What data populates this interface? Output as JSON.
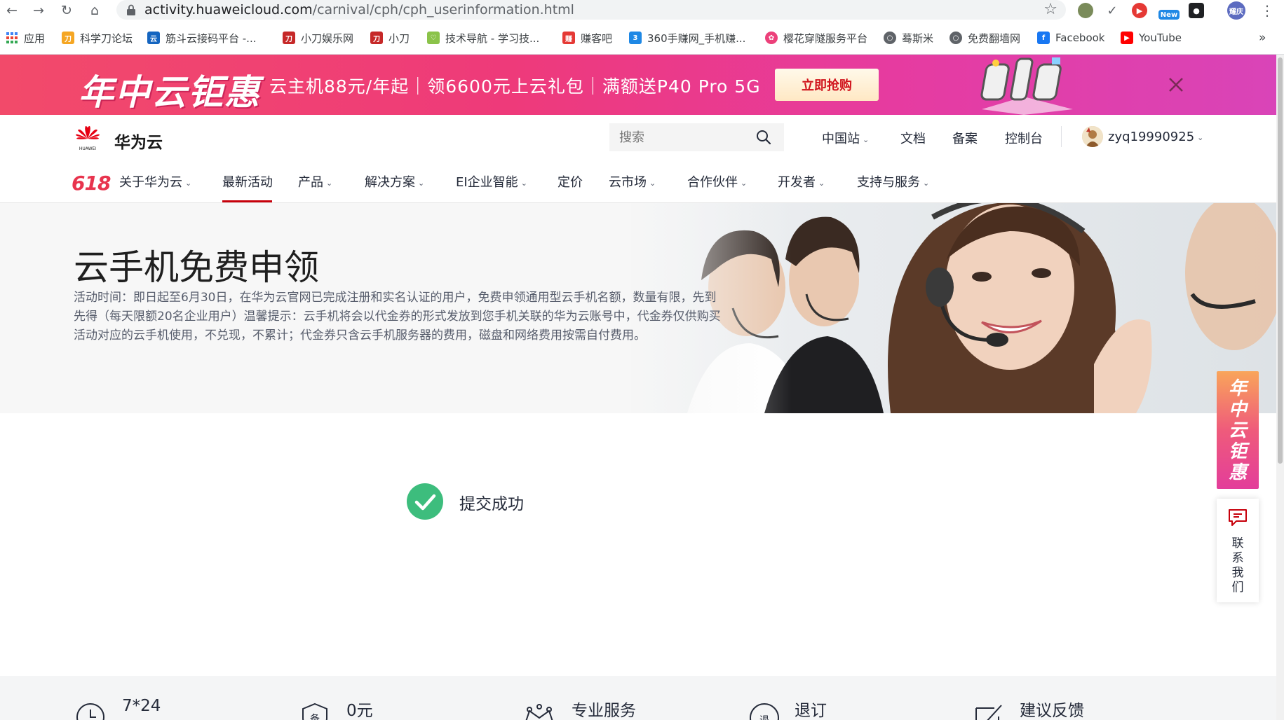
{
  "browser": {
    "url_host": "activity.huaweicloud.com",
    "url_path": "/carnival/cph/cph_userinformation.html",
    "profile_badge": "耀庆",
    "ext_new_badge": "New",
    "bookmarks": [
      {
        "label": "应用",
        "color": "#4285f4",
        "icon": "apps-grid-icon"
      },
      {
        "label": "科学刀论坛",
        "color": "#f5a623",
        "icon": "kxd-favicon"
      },
      {
        "label": "筋斗云接码平台 -...",
        "color": "#1565c0",
        "icon": "jindouyun-favicon"
      },
      {
        "label": "小刀娱乐网",
        "color": "#c62828",
        "icon": "xiaodao-favicon"
      },
      {
        "label": "小刀",
        "color": "#c62828",
        "icon": "xiaodao-favicon"
      },
      {
        "label": "技术导航 - 学习技...",
        "color": "#8bc34a",
        "icon": "jishu-favicon"
      },
      {
        "label": "赚客吧",
        "color": "#e53935",
        "icon": "zhuanke-favicon"
      },
      {
        "label": "360手赚网_手机赚...",
        "color": "#1e88e5",
        "icon": "360-favicon"
      },
      {
        "label": "樱花穿隧服务平台",
        "color": "#ec407a",
        "icon": "sakura-favicon"
      },
      {
        "label": "蓦斯米",
        "color": "#5f6368",
        "icon": "globe-icon"
      },
      {
        "label": "免费翻墙网",
        "color": "#5f6368",
        "icon": "globe-icon"
      },
      {
        "label": "Facebook",
        "color": "#1877f2",
        "icon": "facebook-icon"
      },
      {
        "label": "YouTube",
        "color": "#ff0000",
        "icon": "youtube-icon"
      }
    ],
    "more_bookmarks": "»"
  },
  "promo": {
    "logo_text": "年中云钜惠",
    "text": "云主机88元/年起｜领6600元上云礼包｜满额送P40 Pro 5G",
    "button_label": "立即抢购"
  },
  "header": {
    "brand": "华为云",
    "logo_small_text": "HUAWEI",
    "search_placeholder": "搜索",
    "links": {
      "region": "中国站",
      "docs": "文档",
      "filing": "备案",
      "console": "控制台"
    },
    "username": "zyq19990925"
  },
  "nav": {
    "badge": "618",
    "items": [
      {
        "label": "关于华为云",
        "dropdown": true
      },
      {
        "label": "最新活动",
        "dropdown": false,
        "active": true
      },
      {
        "label": "产品",
        "dropdown": true
      },
      {
        "label": "解决方案",
        "dropdown": true
      },
      {
        "label": "EI企业智能",
        "dropdown": true
      },
      {
        "label": "定价",
        "dropdown": false
      },
      {
        "label": "云市场",
        "dropdown": true
      },
      {
        "label": "合作伙伴",
        "dropdown": true
      },
      {
        "label": "开发者",
        "dropdown": true
      },
      {
        "label": "支持与服务",
        "dropdown": true
      }
    ]
  },
  "hero": {
    "title": "云手机免费申领",
    "description": "活动时间：即日起至6月30日，在华为云官网已完成注册和实名认证的用户，免费申领通用型云手机名额，数量有限，先到先得（每天限额20名企业用户）温馨提示：云手机将会以代金券的形式发放到您手机关联的华为云账号中，代金券仅供购买活动对应的云手机使用，不兑现，不累计；代金券只含云手机服务器的费用，磁盘和网络费用按需自付费用。"
  },
  "result": {
    "message": "提交成功",
    "accent": "#3dbd7d"
  },
  "side": {
    "promo_text": "年中云钜惠",
    "contact_label": "联系我们"
  },
  "footer": {
    "items": [
      {
        "label": "7*24",
        "icon": "clock-icon"
      },
      {
        "label": "0元",
        "icon": "filing-shield-icon"
      },
      {
        "label": "专业服务",
        "icon": "crown-icon"
      },
      {
        "label": "退订",
        "icon": "refund-icon"
      },
      {
        "label": "建议反馈",
        "icon": "feedback-icon"
      }
    ]
  },
  "colors": {
    "brand_red": "#c7000b",
    "promo_pink": "#ee3a7a",
    "text": "#252b3a"
  }
}
